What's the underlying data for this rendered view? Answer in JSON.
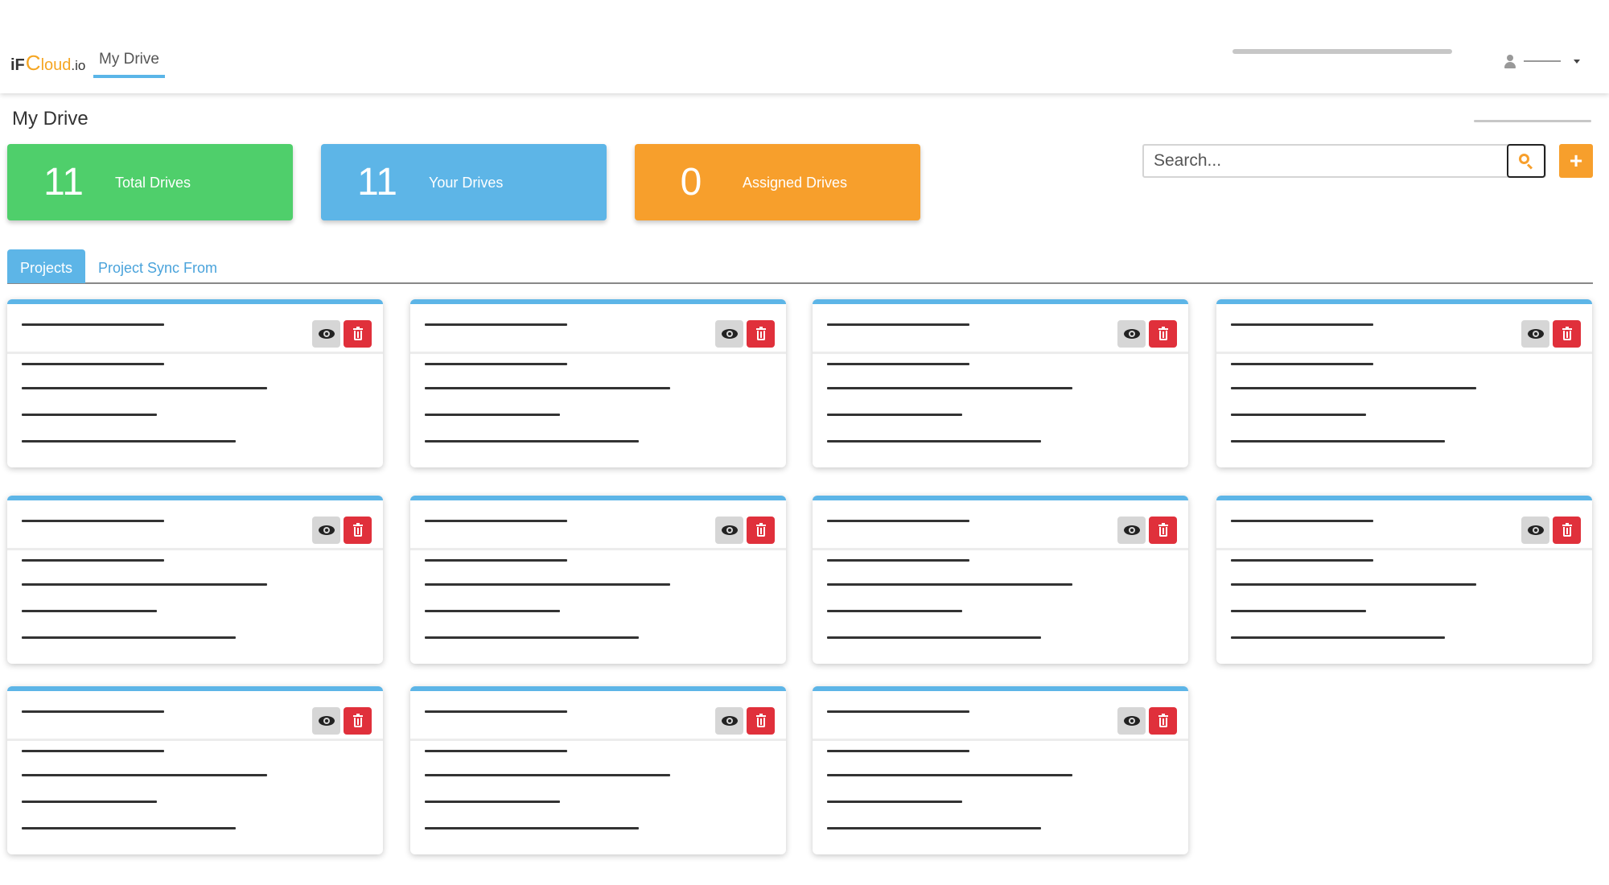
{
  "app": {
    "logo_prefix": "iF",
    "logo_c": "C",
    "logo_rest": "loud",
    "logo_suffix": ".io"
  },
  "navbar": {
    "tab_label": "My Drive"
  },
  "page": {
    "title": "My Drive"
  },
  "stats": [
    {
      "value": "11",
      "label": "Total Drives",
      "color": "#4fcf6b"
    },
    {
      "value": "11",
      "label": "Your Drives",
      "color": "#5db5e7"
    },
    {
      "value": "0",
      "label": "Assigned Drives",
      "color": "#f79f2c"
    }
  ],
  "search": {
    "placeholder": "Search...",
    "value": ""
  },
  "actions": {
    "add_label": "+"
  },
  "tabs": [
    {
      "label": "Projects",
      "active": true
    },
    {
      "label": "Project Sync From",
      "active": false
    }
  ],
  "project_cards_count": 11,
  "colors": {
    "accent": "#5db5e7",
    "success": "#4fcf6b",
    "warning": "#f79f2c",
    "danger": "#e0303b"
  },
  "icons": {
    "user": "user-icon",
    "caret": "caret-down-icon",
    "search": "search-icon",
    "add": "plus-icon",
    "view": "eye-icon",
    "delete": "trash-icon"
  }
}
